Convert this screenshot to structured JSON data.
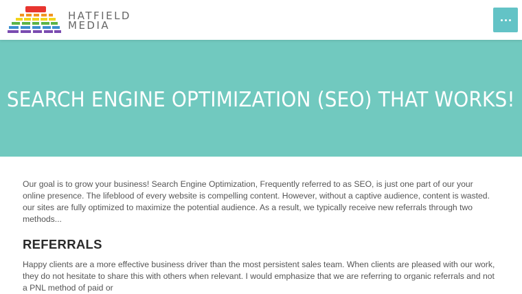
{
  "header": {
    "logo_line1": "HATFIELD",
    "logo_line2": "MEDIA",
    "menu_icon": "more-horizontal-icon",
    "accent_color": "#63c3c6"
  },
  "hero": {
    "title": "SEARCH ENGINE OPTIMIZATION (SEO) THAT WORKS!",
    "background_color": "#71c9bf"
  },
  "content": {
    "intro": "Our goal is to grow your business! Search Engine Optimization, Frequently referred to as SEO, is just one part of our your online presence. The lifeblood of every website is compelling content. However, without a captive audience, content is wasted. our sites are fully optimized to maximize the potential audience. As a result, we typically receive new referrals through two methods...",
    "section_title": "REFERRALS",
    "section_text": "Happy clients are a more effective business driver than the most persistent sales team. When clients are pleased with our work, they do not hesitate to share this with others when relevant. I would emphasize that we are referring to organic referrals and not a PNL method of paid or"
  }
}
